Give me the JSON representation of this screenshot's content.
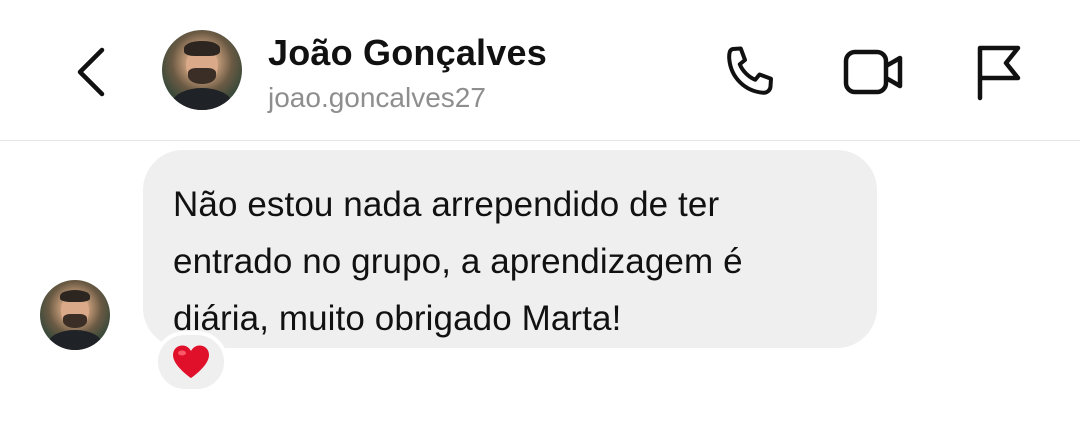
{
  "header": {
    "back_icon": "chevron-left-icon",
    "name": "João Gonçalves",
    "username": "joao.goncalves27",
    "actions": {
      "call_icon": "phone-icon",
      "video_icon": "video-camera-icon",
      "report_icon": "flag-icon"
    }
  },
  "conversation": {
    "messages": [
      {
        "sender": "João Gonçalves",
        "text": "Não estou nada arrependido de ter\nentrado no grupo, a aprendizagem é\ndiária, muito obrigado Marta!",
        "reaction": "heart-icon"
      }
    ]
  },
  "colors": {
    "bubble_background": "#efefef",
    "text_primary": "#111111",
    "text_secondary": "#8e8e8e",
    "reaction_heart": "#e0102a"
  }
}
